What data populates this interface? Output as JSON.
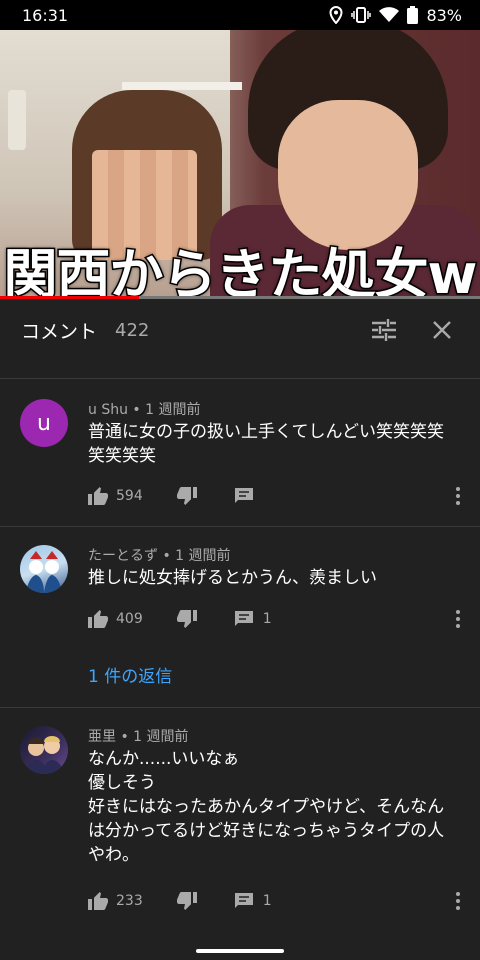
{
  "status_bar": {
    "time": "16:31",
    "battery": "83%"
  },
  "video": {
    "caption": "関西からきた処女w",
    "progress": 0.29
  },
  "comments_header": {
    "title": "コメント",
    "count": "422"
  },
  "comments": [
    {
      "avatar_letter": "u",
      "avatar_color": "#9c27b0",
      "author": "u Shu",
      "time": "1 週間前",
      "meta": "u Shu • 1 週間前",
      "text": "普通に女の子の扱い上手くてしんどい笑笑笑笑\n笑笑笑笑",
      "likes": "594",
      "replies": ""
    },
    {
      "author": "たーとるず",
      "time": "1 週間前",
      "meta": "たーとるず • 1 週間前",
      "text": "推しに処女捧げるとかうん、羨ましい",
      "likes": "409",
      "replies": "1",
      "reply_link": "1 件の返信"
    },
    {
      "author": "亜里",
      "time": "1 週間前",
      "meta": "亜里 • 1 週間前",
      "text": "なんか......いいなぁ\n優しそう\n好きにはなったあかんタイプやけど、そんなん\nは分かってるけど好きになっちゃうタイプの人\nやわ。",
      "likes": "233",
      "replies": "1"
    }
  ],
  "colors": {
    "background": "#212121",
    "link": "#3ea6ff",
    "progress": "#ee0000"
  }
}
